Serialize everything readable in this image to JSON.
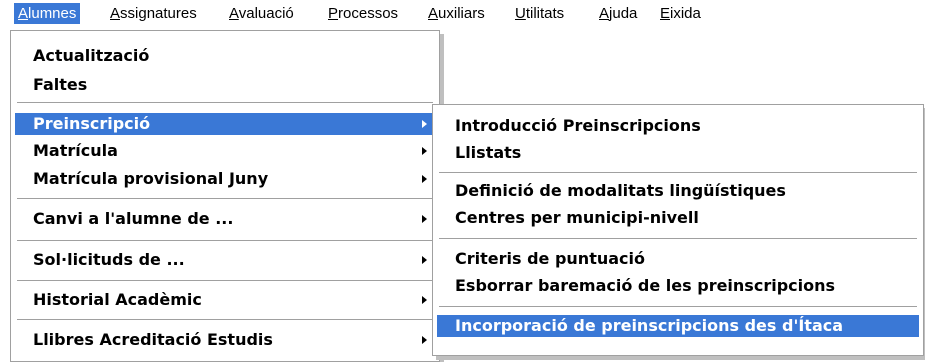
{
  "menubar": {
    "items": [
      {
        "first": "A",
        "rest": "lumnes"
      },
      {
        "first": "A",
        "rest": "ssignatures"
      },
      {
        "first": "A",
        "rest": "valuació"
      },
      {
        "first": "P",
        "rest": "rocessos"
      },
      {
        "first": "A",
        "rest": "uxiliars"
      },
      {
        "first": "U",
        "rest": "tilitats"
      },
      {
        "first": "A",
        "rest": "juda"
      },
      {
        "first": "E",
        "rest": "ixida"
      }
    ]
  },
  "alumnes_menu": {
    "items": [
      {
        "label": "Actualització"
      },
      {
        "label": "Faltes"
      },
      {
        "label": "Preinscripció"
      },
      {
        "label": "Matrícula"
      },
      {
        "label": "Matrícula provisional Juny"
      },
      {
        "label": "Canvi a l'alumne de ..."
      },
      {
        "label": "Sol·licituds de ..."
      },
      {
        "label": "Historial Acadèmic"
      },
      {
        "label": "Llibres Acreditació Estudis"
      }
    ]
  },
  "preinscripcio_menu": {
    "items": [
      {
        "label": "Introducció Preinscripcions"
      },
      {
        "label": "Llistats"
      },
      {
        "label": "Definició de modalitats lingüístiques"
      },
      {
        "label": "Centres per municipi-nivell"
      },
      {
        "label": "Criteris de puntuació"
      },
      {
        "label": "Esborrar baremació de les preinscripcions"
      },
      {
        "label": "Incorporació de preinscripcions des d'Ítaca"
      }
    ]
  },
  "colors": {
    "highlight": "#3a78d6",
    "highlight_text": "#ffffff"
  }
}
